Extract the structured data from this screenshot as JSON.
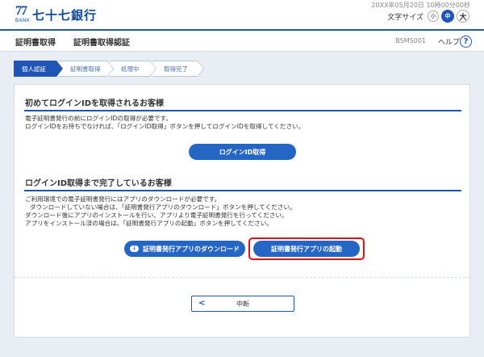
{
  "header": {
    "logo_mark": "77",
    "logo_bank": "BANK",
    "bank_name": "七十七銀行",
    "datetime": "20XX年05月20日 10時00分00秒",
    "font_size_label": "文字サイズ",
    "font_sizes": [
      "小",
      "中",
      "大"
    ],
    "font_size_selected": "中"
  },
  "pagebar": {
    "title": "証明書取得",
    "subtitle": "証明書取得認証",
    "screen_id": "BSMS001",
    "help": "ヘルプ",
    "help_icon_glyph": "?"
  },
  "steps": [
    "個人認証",
    "証明書取得",
    "処理中",
    "取得完了"
  ],
  "active_step": 0,
  "section1": {
    "title": "初めてログインIDを取得されるお客様",
    "lines": [
      "電子証明書発行の前にログインIDの取得が必要です。",
      "ログインIDをお持ちでなければ、「ログインID取得」ボタンを押してログインIDを取得してください。"
    ],
    "button": "ログインID取得"
  },
  "section2": {
    "title": "ログインID取得まで完了しているお客様",
    "lines": [
      "ご利用環境での電子証明書発行にはアプリのダウンロードが必要です。",
      "ダウンロードしていない場合は、「証明書発行アプリのダウンロード」ボタンを押してください。",
      "ダウンロード後にアプリのインストールを行い、アプリより電子証明書発行を行ってください。",
      "アプリをインストール済の場合は、「証明書発行アプリの起動」ボタンを押してください。"
    ],
    "download_button": "証明書発行アプリのダウンロード",
    "launch_button": "証明書発行アプリの起動"
  },
  "cancel_button": "中断",
  "colors": {
    "brand": "#0d49a0",
    "accent": "#1f56b5",
    "button": "#2565c4",
    "highlight": "#e0101a",
    "background": "#e9eef4"
  }
}
